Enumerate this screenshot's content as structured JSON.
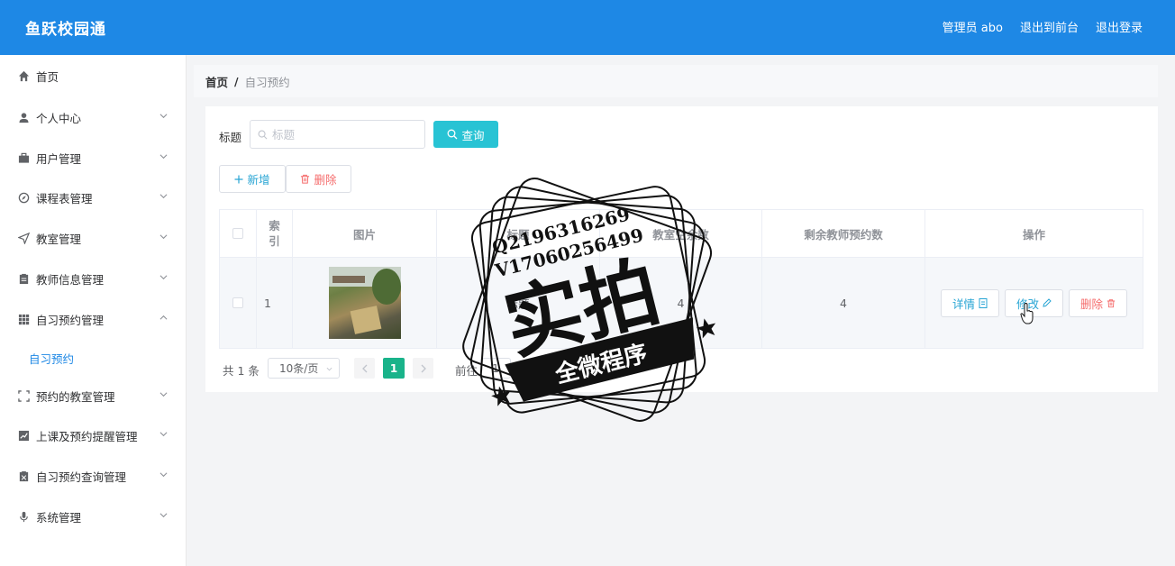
{
  "header": {
    "brand": "鱼跃校园通",
    "user": "管理员 abo",
    "to_front": "退出到前台",
    "logout": "退出登录"
  },
  "sidebar": {
    "items": [
      {
        "label": "首页",
        "icon": "home-icon"
      },
      {
        "label": "个人中心",
        "icon": "user-icon"
      },
      {
        "label": "用户管理",
        "icon": "briefcase-icon"
      },
      {
        "label": "课程表管理",
        "icon": "compass-icon"
      },
      {
        "label": "教室管理",
        "icon": "send-icon"
      },
      {
        "label": "教师信息管理",
        "icon": "clipboard-icon"
      },
      {
        "label": "自习预约管理",
        "icon": "grid-icon"
      },
      {
        "label": "预约的教室管理",
        "icon": "fullscreen-icon"
      },
      {
        "label": "上课及预约提醒管理",
        "icon": "chart-icon"
      },
      {
        "label": "自习预约查询管理",
        "icon": "clipboard-icon"
      },
      {
        "label": "系统管理",
        "icon": "mic-icon"
      }
    ],
    "submenu_active": "自习预约"
  },
  "breadcrumb": {
    "home": "首页",
    "separator": "/",
    "current": "自习预约"
  },
  "search": {
    "label": "标题",
    "placeholder": "标题",
    "value": "",
    "button": "查询"
  },
  "actions": {
    "add": "新增",
    "delete": "删除"
  },
  "table": {
    "columns": [
      "索引",
      "图片",
      "标题",
      "教室空余数",
      "剩余教师预约数",
      "操作"
    ],
    "rows": [
      {
        "index": "1",
        "title": "标题",
        "free_rooms": "4",
        "teacher_remaining": "4"
      }
    ],
    "ops": {
      "detail": "详情",
      "edit": "修改",
      "delete": "删除"
    }
  },
  "pagination": {
    "total": "共 1 条",
    "page_size": "10条/页",
    "current": "1",
    "goto": "前往",
    "goto_value": "1",
    "page_unit": "页"
  },
  "watermark": {
    "contact1": "Q2196316269",
    "contact2": "V17060256499",
    "big_text": "实拍",
    "banner": "全微程序"
  },
  "colors": {
    "header": "#1e88e5",
    "query_button": "#28c3d4",
    "active_page": "#19b38a",
    "danger": "#f56c6c"
  }
}
